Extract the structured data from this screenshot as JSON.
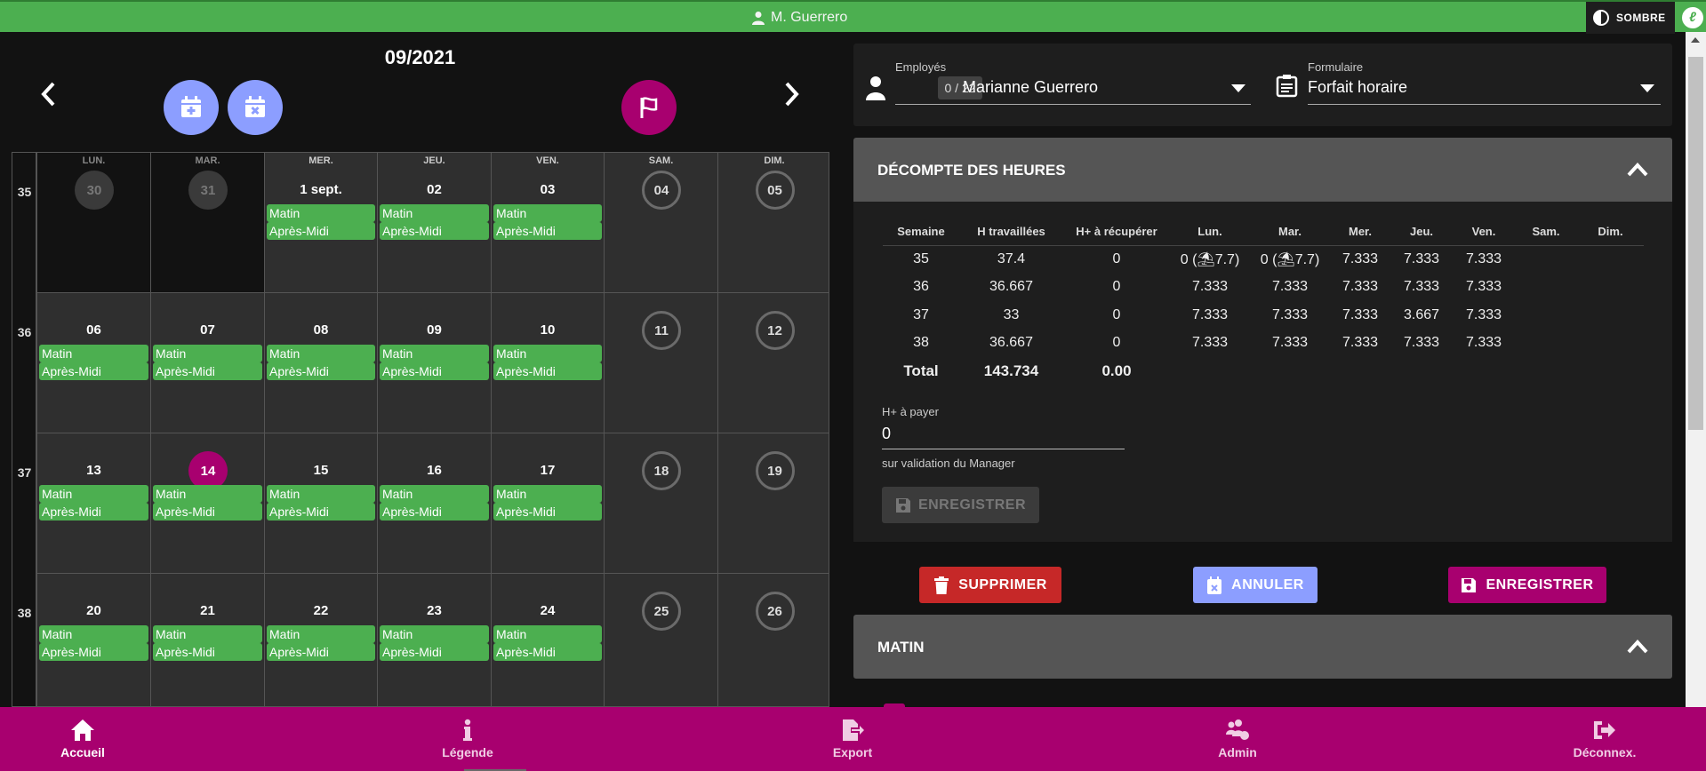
{
  "topbar": {
    "user": "M. Guerrero",
    "theme_label": "SOMBRE",
    "brand_letter": "ℓ"
  },
  "calendar": {
    "month": "09/2021",
    "days_of_week": [
      "LUN.",
      "MAR.",
      "MER.",
      "JEU.",
      "VEN.",
      "SAM.",
      "DIM."
    ],
    "weeks": [
      {
        "num": "35",
        "days": [
          "30",
          "31",
          "1 sept.",
          "02",
          "03",
          "04",
          "05"
        ]
      },
      {
        "num": "36",
        "days": [
          "06",
          "07",
          "08",
          "09",
          "10",
          "11",
          "12"
        ]
      },
      {
        "num": "37",
        "days": [
          "13",
          "14",
          "15",
          "16",
          "17",
          "18",
          "19"
        ]
      },
      {
        "num": "38",
        "days": [
          "20",
          "21",
          "22",
          "23",
          "24",
          "25",
          "26"
        ]
      }
    ],
    "slot_morning": "Matin",
    "slot_afternoon": "Après-Midi",
    "colors": {
      "slot": "#4caf50",
      "today": "#a8006f",
      "add_btn": "#8c9eff",
      "flag_btn": "#a8006f"
    }
  },
  "employee": {
    "label": "Employés",
    "count": "0 / 22",
    "name": "Marianne Guerrero",
    "form_label": "Formulaire",
    "form_value": "Forfait horaire"
  },
  "hours": {
    "title": "DÉCOMPTE DES HEURES",
    "columns": [
      "Semaine",
      "H travaillées",
      "H+ à récupérer",
      "Lun.",
      "Mar.",
      "Mer.",
      "Jeu.",
      "Ven.",
      "Sam.",
      "Dim."
    ],
    "rows": [
      [
        "35",
        "37.4",
        "0",
        "0 (⛱7.7)",
        "0 (⛱7.7)",
        "7.333",
        "7.333",
        "7.333",
        "",
        ""
      ],
      [
        "36",
        "36.667",
        "0",
        "7.333",
        "7.333",
        "7.333",
        "7.333",
        "7.333",
        "",
        ""
      ],
      [
        "37",
        "33",
        "0",
        "7.333",
        "7.333",
        "7.333",
        "3.667",
        "7.333",
        "",
        ""
      ],
      [
        "38",
        "36.667",
        "0",
        "7.333",
        "7.333",
        "7.333",
        "7.333",
        "7.333",
        "",
        ""
      ]
    ],
    "total": [
      "Total",
      "143.734",
      "0.00"
    ],
    "hplus_label": "H+ à payer",
    "hplus_value": "0",
    "hplus_hint": "sur validation du Manager",
    "save_label": "ENREGISTRER"
  },
  "actions": {
    "delete": "SUPPRIMER",
    "cancel": "ANNULER",
    "save": "ENREGISTRER"
  },
  "morning_panel": {
    "title": "MATIN"
  },
  "bottom_nav": [
    {
      "label": "Accueil",
      "icon": "home-icon"
    },
    {
      "label": "Légende",
      "icon": "info-icon"
    },
    {
      "label": "Export",
      "icon": "export-icon"
    },
    {
      "label": "Admin",
      "icon": "users-cog-icon"
    },
    {
      "label": "Déconnex.",
      "icon": "logout-icon"
    }
  ]
}
